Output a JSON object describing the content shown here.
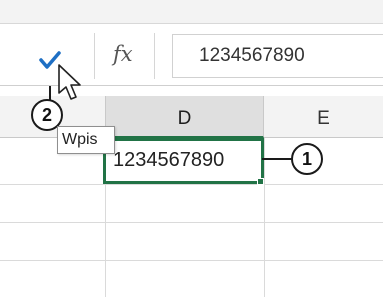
{
  "formula_bar": {
    "confirm_icon": "checkmark-icon",
    "function_label": "fx",
    "value": "1234567890",
    "accent_color": "#1e6fc4"
  },
  "columns": {
    "d": "D",
    "e": "E"
  },
  "active_cell": {
    "value": "1234567890",
    "border_color": "#217346"
  },
  "tooltip": {
    "text": "Wpis"
  },
  "callouts": {
    "one": "1",
    "two": "2"
  },
  "pointer_icon": "mouse-pointer-icon"
}
